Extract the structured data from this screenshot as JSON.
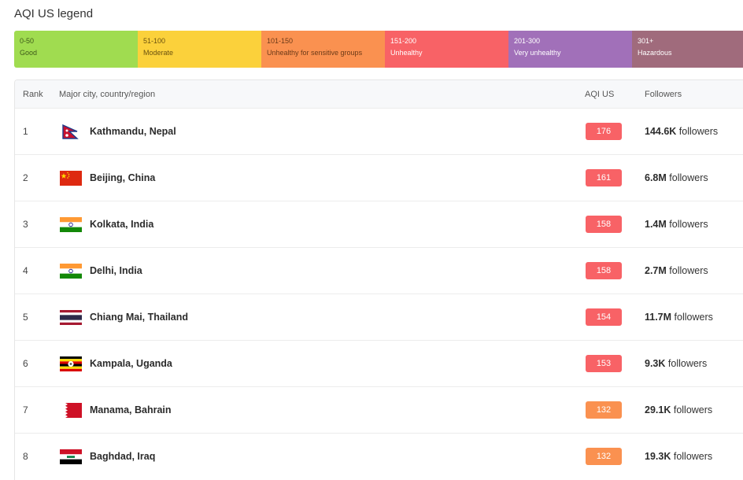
{
  "legend": {
    "title": "AQI US legend",
    "segments": [
      {
        "range": "0-50",
        "label": "Good",
        "color": "#a0dc50",
        "text_color": "#3e5a1a"
      },
      {
        "range": "51-100",
        "label": "Moderate",
        "color": "#fbd13b",
        "text_color": "#6b5210"
      },
      {
        "range": "101-150",
        "label": "Unhealthy for sensitive groups",
        "color": "#fa9150",
        "text_color": "#6b3a18"
      },
      {
        "range": "151-200",
        "label": "Unhealthy",
        "color": "#f86266",
        "text_color": "#ffffff"
      },
      {
        "range": "201-300",
        "label": "Very unhealthy",
        "color": "#a170b9",
        "text_color": "#ffffff"
      },
      {
        "range": "301+",
        "label": "Hazardous",
        "color": "#a06b7c",
        "text_color": "#ffffff"
      }
    ]
  },
  "table": {
    "headers": {
      "rank": "Rank",
      "city": "Major city, country/region",
      "aqi": "AQI US",
      "followers": "Followers"
    },
    "followers_suffix": "followers",
    "rows": [
      {
        "rank": "1",
        "city": "Kathmandu, Nepal",
        "flag": "nepal-flag-icon",
        "aqi": "176",
        "aqi_color": "#f86266",
        "followers": "144.6K"
      },
      {
        "rank": "2",
        "city": "Beijing, China",
        "flag": "china-flag-icon",
        "aqi": "161",
        "aqi_color": "#f86266",
        "followers": "6.8M"
      },
      {
        "rank": "3",
        "city": "Kolkata, India",
        "flag": "india-flag-icon",
        "aqi": "158",
        "aqi_color": "#f86266",
        "followers": "1.4M"
      },
      {
        "rank": "4",
        "city": "Delhi, India",
        "flag": "india-flag-icon",
        "aqi": "158",
        "aqi_color": "#f86266",
        "followers": "2.7M"
      },
      {
        "rank": "5",
        "city": "Chiang Mai, Thailand",
        "flag": "thailand-flag-icon",
        "aqi": "154",
        "aqi_color": "#f86266",
        "followers": "11.7M"
      },
      {
        "rank": "6",
        "city": "Kampala, Uganda",
        "flag": "uganda-flag-icon",
        "aqi": "153",
        "aqi_color": "#f86266",
        "followers": "9.3K"
      },
      {
        "rank": "7",
        "city": "Manama, Bahrain",
        "flag": "bahrain-flag-icon",
        "aqi": "132",
        "aqi_color": "#fa9150",
        "followers": "29.1K"
      },
      {
        "rank": "8",
        "city": "Baghdad, Iraq",
        "flag": "iraq-flag-icon",
        "aqi": "132",
        "aqi_color": "#fa9150",
        "followers": "19.3K"
      }
    ]
  }
}
